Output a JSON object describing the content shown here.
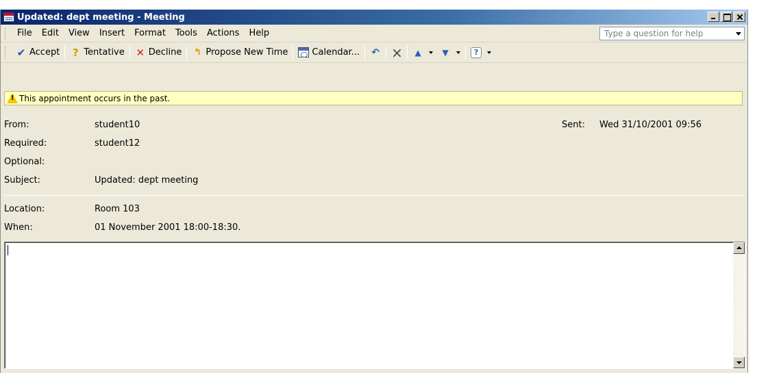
{
  "window": {
    "title": "Updated: dept meeting - Meeting"
  },
  "menubar": {
    "items": [
      "File",
      "Edit",
      "View",
      "Insert",
      "Format",
      "Tools",
      "Actions",
      "Help"
    ],
    "help_placeholder": "Type a question for help"
  },
  "toolbar": {
    "accept_label": "Accept",
    "tentative_label": "Tentative",
    "decline_label": "Decline",
    "propose_label": "Propose New Time",
    "calendar_label": "Calendar...",
    "icons": {
      "accept": "check-icon",
      "tentative": "question-icon",
      "decline": "x-icon",
      "propose": "arrow-icon",
      "calendar": "calendar-icon",
      "reply": "reply-icon",
      "delete": "delete-icon",
      "previous": "up-arrow-icon",
      "next": "down-arrow-icon",
      "help": "help-icon"
    }
  },
  "infobar": {
    "message": "This appointment occurs in the past."
  },
  "header": {
    "from_label": "From:",
    "from_value": "student10",
    "required_label": "Required:",
    "required_value": "student12",
    "optional_label": "Optional:",
    "optional_value": "",
    "subject_label": "Subject:",
    "subject_value": "Updated: dept meeting",
    "sent_label": "Sent:",
    "sent_value": "Wed 31/10/2001 09:56"
  },
  "details": {
    "location_label": "Location:",
    "location_value": "Room 103",
    "when_label": "When:",
    "when_value": "01 November 2001 18:00-18:30."
  },
  "colors": {
    "titlebar_start": "#0a246a",
    "titlebar_end": "#a6caf0",
    "window_bg": "#ece9d8",
    "infobar_bg": "#ffffc0"
  }
}
